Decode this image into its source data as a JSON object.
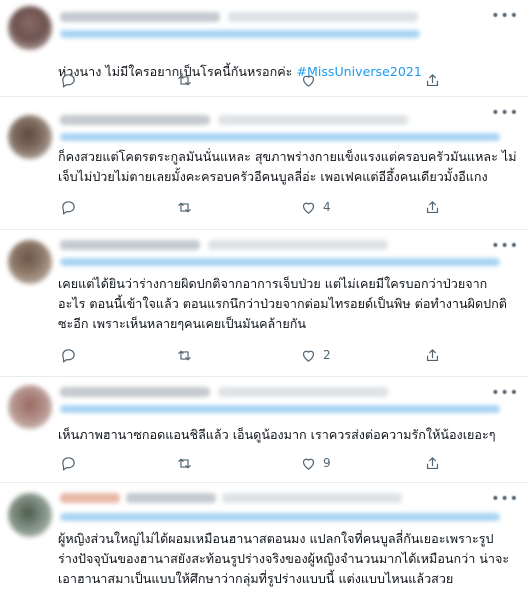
{
  "colors": {
    "accent": "#1d9bf0",
    "text": "#0f1419",
    "muted": "#536471",
    "divider": "#e6ecf0"
  },
  "icons": [
    "reply-icon",
    "retweet-icon",
    "like-icon",
    "share-icon",
    "more-icon"
  ],
  "tweets": [
    {
      "text": "ห่วงนาง ไม่มีใครอยากเป็นโรคนี้กันหรอกค่ะ ",
      "hashtag": "#MissUniverse2021",
      "likes": ""
    },
    {
      "text": "ก็คงสวยแต่โคตรตระกูลมันนั่นแหละ สุขภาพร่างกายแข็งแรงแต่ครอบครัวมันแหละ ไม่\nเจ็บไม่ป่วยไม่ตายเลยมั้งคะครอบครัวอีคนบูลลี่อ่ะ เพอเฟคแต่อีอึ้งคนเดียวมั้งอีแกง",
      "hashtag": "",
      "likes": "4"
    },
    {
      "text": "เคยแต่ได้ยินว่าร่างกายผิดปกติจากอาการเจ็บป่วย แต่ไม่เคยมีใครบอกว่าป่วยจาก\nอะไร ตอนนี้เข้าใจแล้ว ตอนแรกนึกว่าป่วยจากต่อมไทรอยด์เป็นพิษ ต่อทำงานผิดปกติ\nซะอีก เพราะเห็นหลายๆคนเคยเป็นมันคล้ายกัน",
      "hashtag": "",
      "likes": "2"
    },
    {
      "text": "เห็นภาพฮานาซกอดแอนชิลีแล้ว เอ็นดูน้องมาก เราควรส่งต่อความรักให้น้องเยอะๆ",
      "hashtag": "",
      "likes": "9"
    },
    {
      "text": "ผู้หญิงส่วนใหญ่ไม่ได้ผอมเหมือนฮานาสตอนมง แปลกใจที่คนบูลลี่กันเยอะเพราะรูป\nร่างปัจจุบันของฮานาสยังสะท้อนรูปร่างจริงของผู้หญิงจำนวนมากได้เหมือนกว่า น่าจะ\nเอาฮานาสมาเป็นแบบให้ศึกษาว่ากลุ่มที่รูปร่างแบบนี้ แต่งแบบไหนแล้วสวย",
      "hashtag": "",
      "likes": ""
    }
  ]
}
